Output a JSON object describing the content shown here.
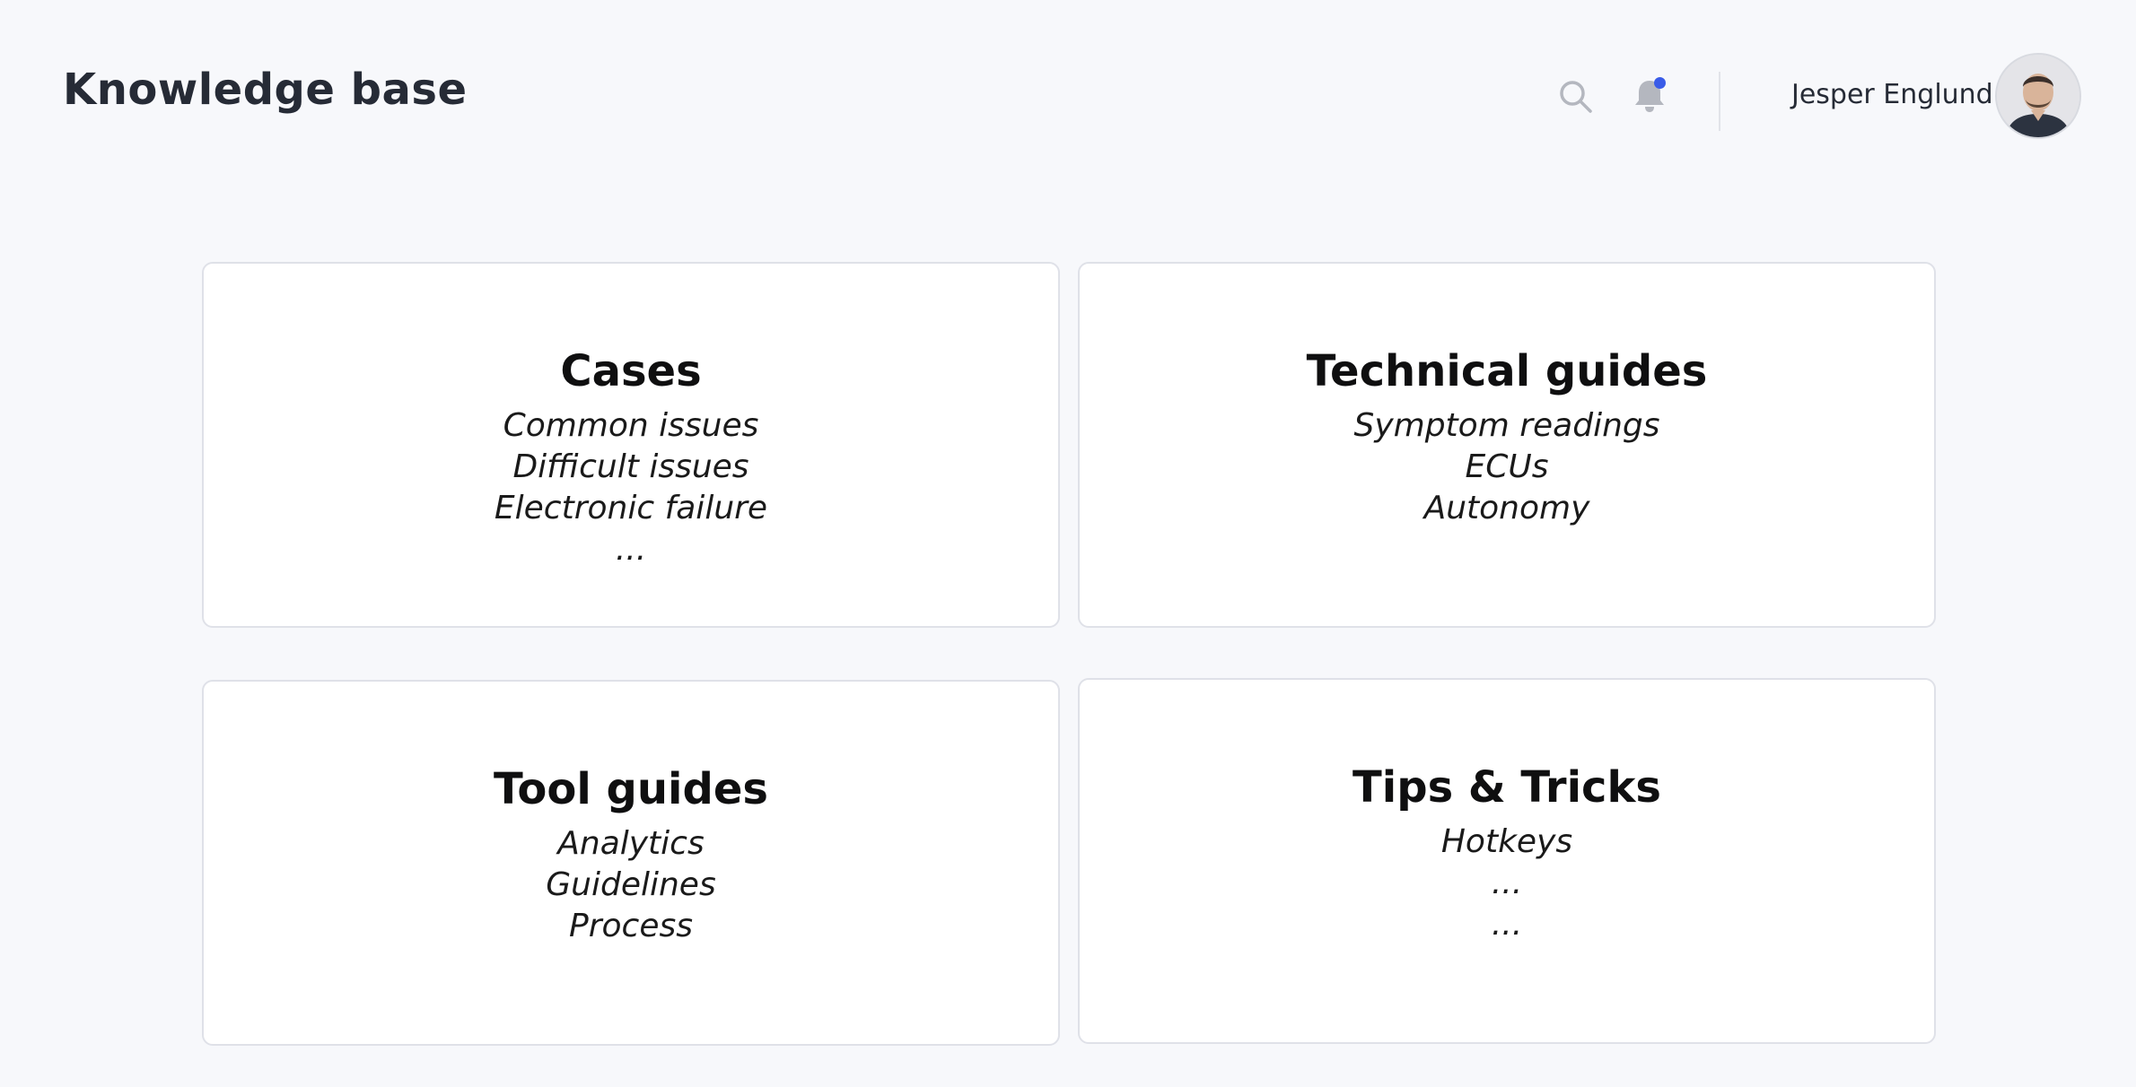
{
  "header": {
    "title": "Knowledge base",
    "search_icon": "search-icon",
    "bell_icon": "bell-icon",
    "user_name": "Jesper Englund",
    "notification_dot_color": "#3a5ce8"
  },
  "cards": [
    {
      "title": "Cases",
      "items": [
        "Common issues",
        "Difficult issues",
        "Electronic failure",
        "..."
      ]
    },
    {
      "title": "Technical guides",
      "items": [
        "Symptom readings",
        "ECUs",
        "Autonomy"
      ]
    },
    {
      "title": "Tool guides",
      "items": [
        "Analytics",
        "Guidelines",
        "Process"
      ]
    },
    {
      "title": "Tips & Tricks",
      "items": [
        "Hotkeys",
        "...",
        "..."
      ]
    }
  ],
  "colors": {
    "background": "#f7f8fb",
    "card_background": "#ffffff",
    "card_border": "#dfe1e8",
    "icon_gray": "#b4b7bf"
  }
}
